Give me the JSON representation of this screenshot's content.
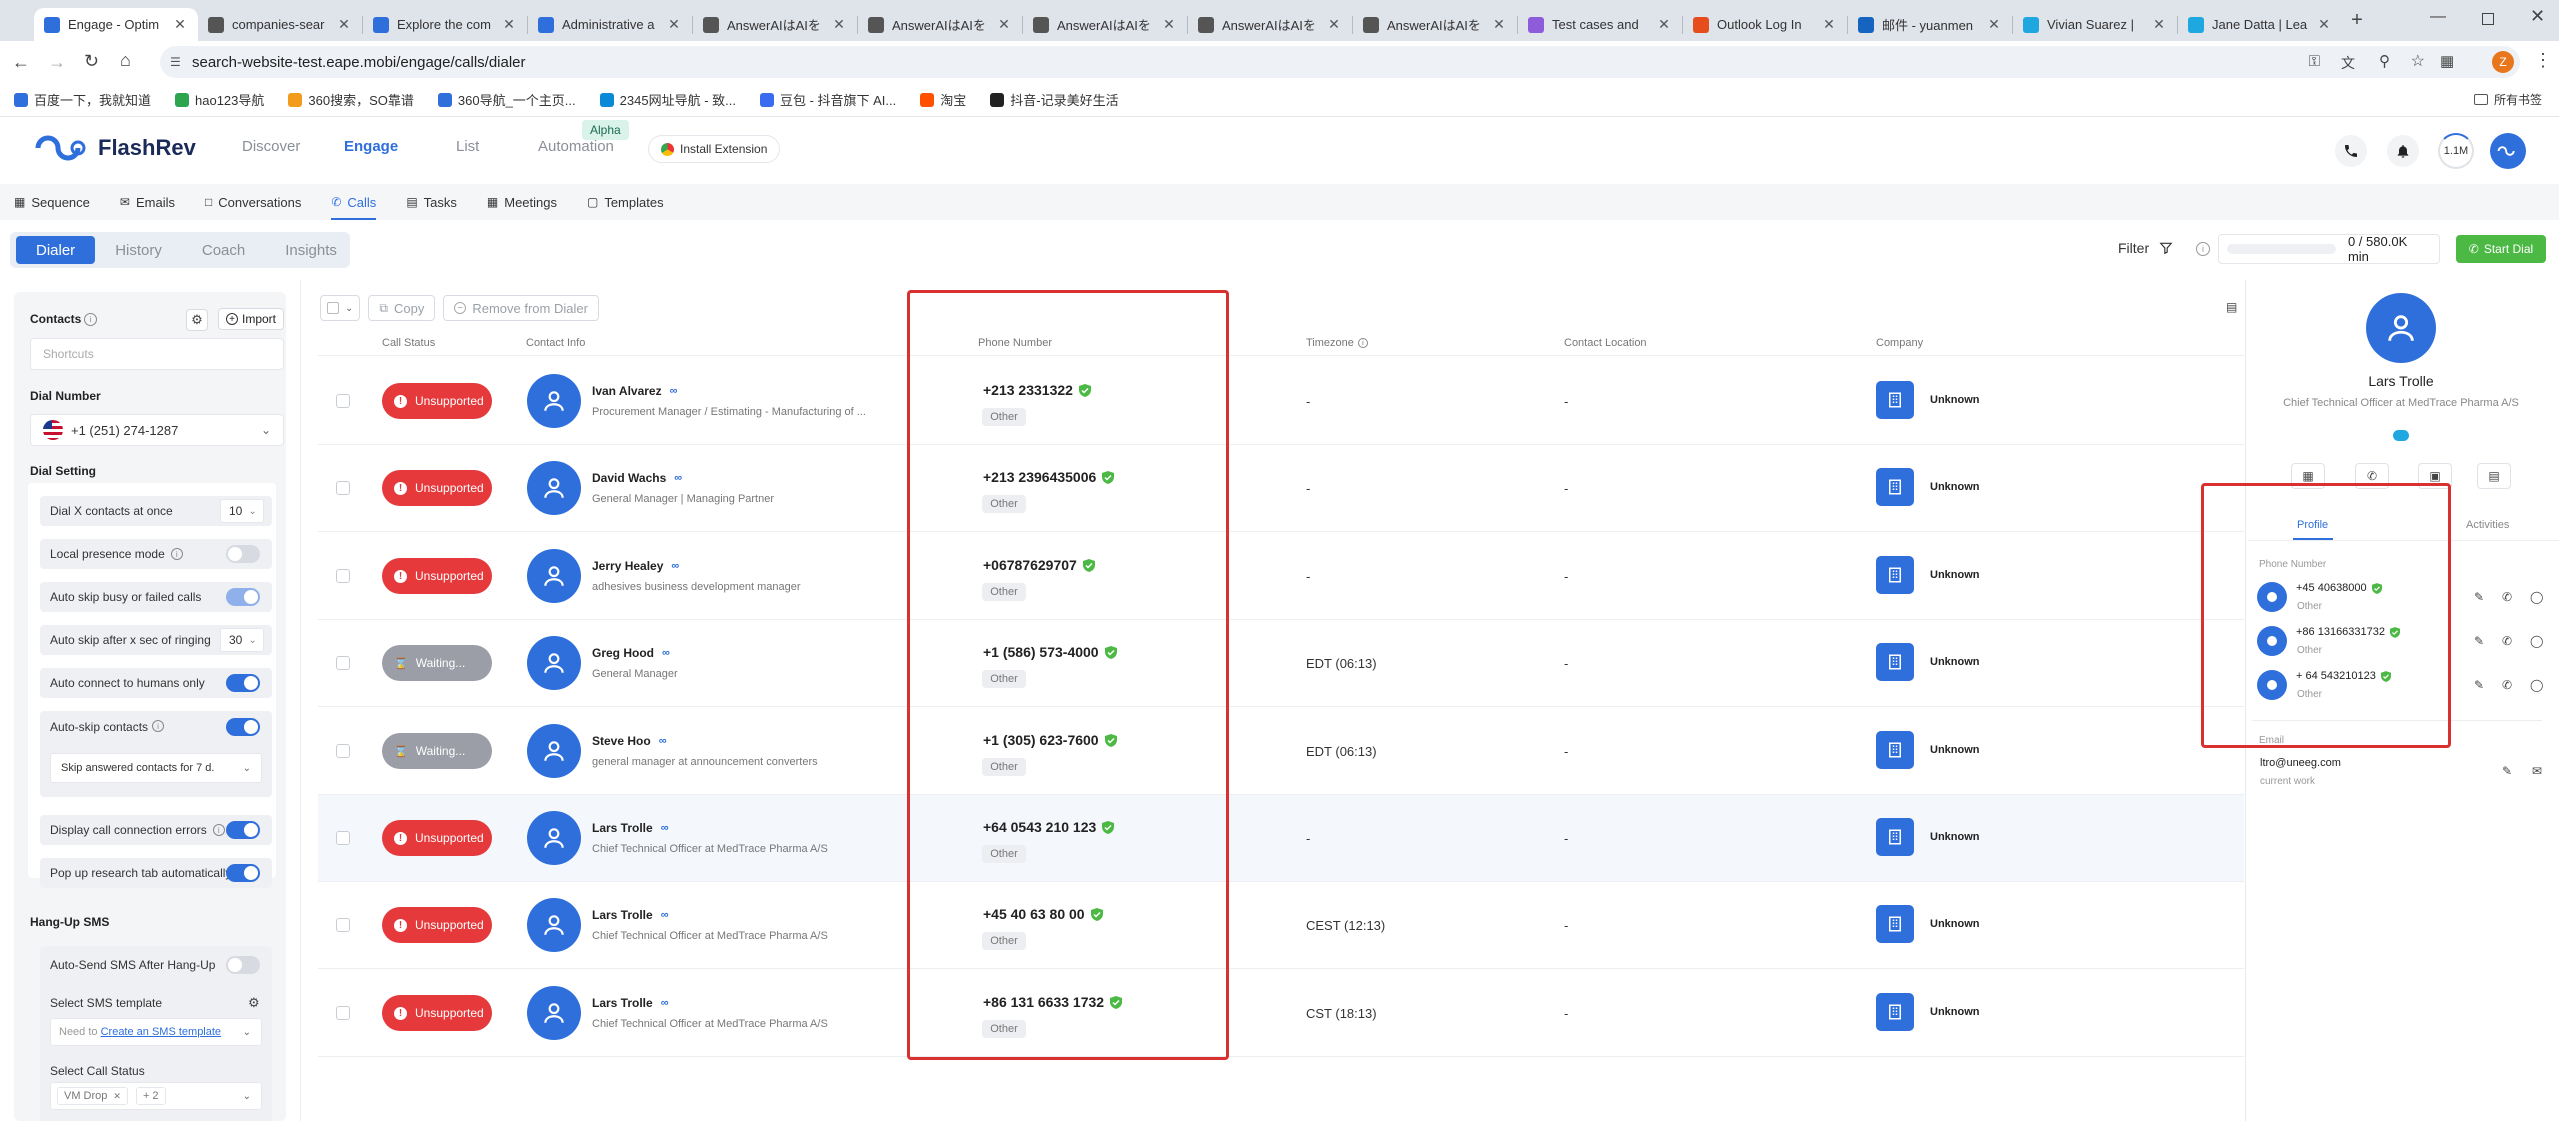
{
  "browser": {
    "tabs": [
      {
        "title": "Engage - Optim",
        "active": true,
        "color": "#2f6fdc"
      },
      {
        "title": "companies-sear",
        "color": "#555555"
      },
      {
        "title": "Explore the com",
        "color": "#2f6fdc"
      },
      {
        "title": "Administrative a",
        "color": "#2f6fdc"
      },
      {
        "title": "AnswerAIはAIを",
        "color": "#555555"
      },
      {
        "title": "AnswerAIはAIを",
        "color": "#555555"
      },
      {
        "title": "AnswerAIはAIを",
        "color": "#555555"
      },
      {
        "title": "AnswerAIはAIを",
        "color": "#555555"
      },
      {
        "title": "AnswerAIはAIを",
        "color": "#555555"
      },
      {
        "title": "Test cases and",
        "color": "#8e5cd9"
      },
      {
        "title": "Outlook Log In",
        "color": "#e74c1c"
      },
      {
        "title": "邮件 - yuanmen",
        "color": "#1565c0"
      },
      {
        "title": "Vivian Suarez |",
        "color": "#1fa7e0"
      },
      {
        "title": "Jane Datta | Lea",
        "color": "#1fa7e0"
      }
    ],
    "url": "search-website-test.eape.mobi/engage/calls/dialer",
    "profile_initial": "Z",
    "bookmarks": [
      "百度一下，我就知道",
      "hao123导航",
      "360搜索，SO靠谱",
      "360导航_一个主页...",
      "2345网址导航 - 致...",
      "豆包 - 抖音旗下 AI...",
      "淘宝",
      "抖音-记录美好生活"
    ],
    "all_bookmarks": "所有书签"
  },
  "app": {
    "brand": "FlashRev",
    "nav": [
      "Discover",
      "Engage",
      "List",
      "Automation"
    ],
    "alpha_badge": "Alpha",
    "install_extension": "Install Extension",
    "credit_badge": "1.1M",
    "subnav": [
      "Sequence",
      "Emails",
      "Conversations",
      "Calls",
      "Tasks",
      "Meetings",
      "Templates"
    ],
    "tabs": [
      "Dialer",
      "History",
      "Coach",
      "Insights"
    ],
    "filter": "Filter",
    "minutes": "0 / 580.0K min",
    "start_dial": "Start Dial"
  },
  "left": {
    "contacts_label": "Contacts",
    "import": "Import",
    "shortcuts_placeholder": "Shortcuts",
    "dial_number_label": "Dial Number",
    "dial_number": "+1 (251) 274-1287",
    "dial_setting_label": "Dial Setting",
    "dial_x_label": "Dial X contacts at once",
    "dial_x_value": "10",
    "local_presence": "Local presence mode",
    "auto_skip_busy": "Auto skip busy or failed calls",
    "auto_skip_after": "Auto skip after x sec of ringing",
    "auto_skip_after_value": "30",
    "auto_connect": "Auto connect to humans only",
    "auto_skip_contacts": "Auto-skip contacts",
    "skip_answered": "Skip answered contacts for 7 d.",
    "display_errors": "Display call connection errors",
    "popup_research": "Pop up research tab automatically",
    "hangup_sms_label": "Hang-Up SMS",
    "auto_send_sms": "Auto-Send SMS After Hang-Up",
    "select_sms_template": "Select SMS template",
    "need_to": "Need to",
    "create_sms_link": "Create an SMS template",
    "select_call_status": "Select Call Status",
    "vm_drop": "VM Drop",
    "plus_more": "+ 2"
  },
  "table": {
    "copy": "Copy",
    "remove": "Remove from Dialer",
    "headers": [
      "Call Status",
      "Contact Info",
      "Phone Number",
      "Timezone",
      "Contact Location",
      "Company"
    ],
    "rows": [
      {
        "status": "Unsupported",
        "status_kind": "red",
        "name": "Ivan Alvarez",
        "title": "Procurement Manager / Estimating - Manufacturing of ...",
        "phone": "+213 2331322",
        "phone_type": "Other",
        "timezone": "-",
        "location": "-",
        "company": "Unknown"
      },
      {
        "status": "Unsupported",
        "status_kind": "red",
        "name": "David Wachs",
        "title": "General Manager | Managing Partner",
        "phone": "+213 2396435006",
        "phone_type": "Other",
        "timezone": "-",
        "location": "-",
        "company": "Unknown"
      },
      {
        "status": "Unsupported",
        "status_kind": "red",
        "name": "Jerry Healey",
        "title": "adhesives business development manager",
        "phone": "+06787629707",
        "phone_type": "Other",
        "timezone": "-",
        "location": "-",
        "company": "Unknown"
      },
      {
        "status": "Waiting...",
        "status_kind": "gray",
        "name": "Greg Hood",
        "title": "General Manager",
        "phone": "+1 (586) 573-4000",
        "phone_type": "Other",
        "timezone": "EDT (06:13)",
        "location": "-",
        "company": "Unknown"
      },
      {
        "status": "Waiting...",
        "status_kind": "gray",
        "name": "Steve Hoo",
        "title": "general manager at announcement converters",
        "phone": "+1 (305) 623-7600",
        "phone_type": "Other",
        "timezone": "EDT (06:13)",
        "location": "-",
        "company": "Unknown"
      },
      {
        "status": "Unsupported",
        "status_kind": "red",
        "name": "Lars Trolle",
        "title": "Chief Technical Officer at MedTrace Pharma A/S",
        "phone": "+64 0543 210 123",
        "phone_type": "Other",
        "timezone": "-",
        "location": "-",
        "company": "Unknown"
      },
      {
        "status": "Unsupported",
        "status_kind": "red",
        "name": "Lars Trolle",
        "title": "Chief Technical Officer at MedTrace Pharma A/S",
        "phone": "+45 40 63 80 00",
        "phone_type": "Other",
        "timezone": "CEST (12:13)",
        "location": "-",
        "company": "Unknown"
      },
      {
        "status": "Unsupported",
        "status_kind": "red",
        "name": "Lars Trolle",
        "title": "Chief Technical Officer at MedTrace Pharma A/S",
        "phone": "+86 131 6633 1732",
        "phone_type": "Other",
        "timezone": "CST (18:13)",
        "location": "-",
        "company": "Unknown"
      }
    ]
  },
  "profile": {
    "name": "Lars Trolle",
    "title": "Chief Technical Officer at MedTrace Pharma A/S",
    "tabs": [
      "Profile",
      "Activities"
    ],
    "phone_label": "Phone Number",
    "phones": [
      {
        "number": "+45 40638000",
        "type": "Other"
      },
      {
        "number": "+86 13166331732",
        "type": "Other"
      },
      {
        "number": "+ 64 543210123",
        "type": "Other"
      }
    ],
    "email_label": "Email",
    "email": "ltro@uneeg.com",
    "email_type": "current work"
  },
  "colors": {
    "accent": "#2f6fdc",
    "danger": "#e5393b",
    "success": "#4cb944",
    "highlight_box": "#d9312f"
  }
}
